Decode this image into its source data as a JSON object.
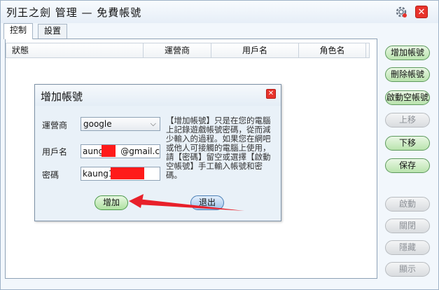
{
  "window": {
    "title": "列王之劍 管理 — 免費帳號"
  },
  "tabs": [
    {
      "label": "控制"
    },
    {
      "label": "設置"
    }
  ],
  "table": {
    "columns": [
      "狀態",
      "運營商",
      "用戶名",
      "角色名"
    ]
  },
  "side_buttons": [
    {
      "label": "增加帳號",
      "enabled": true
    },
    {
      "label": "刪除帳號",
      "enabled": true
    },
    {
      "label": "啟動空帳號",
      "enabled": true
    },
    {
      "label": "上移",
      "enabled": false
    },
    {
      "label": "下移",
      "enabled": true
    },
    {
      "label": "保存",
      "enabled": true
    },
    {
      "label": "啟動",
      "enabled": false
    },
    {
      "label": "關閉",
      "enabled": false
    },
    {
      "label": "隱藏",
      "enabled": false
    },
    {
      "label": "顯示",
      "enabled": false
    }
  ],
  "dialog": {
    "title": "增加帳號",
    "operator_label": "運營商",
    "operator_value": "google",
    "username_label": "用戶名",
    "username_prefix": "aung",
    "username_suffix": "@gmail.com",
    "password_label": "密碼",
    "password_value": "kaung1",
    "description": "【增加帳號】只是在您的電腦上記錄遊戲帳號密碼，從而減少輸入的過程。如果您在網吧或他人可接觸的電腦上使用，請【密碼】留空或選擇【啟動空帳號】手工輸入帳號和密碼。",
    "add_button": "增加",
    "exit_button": "退出"
  },
  "colors": {
    "annotation_red": "#e8202a",
    "redaction": "#ff1a1a"
  }
}
